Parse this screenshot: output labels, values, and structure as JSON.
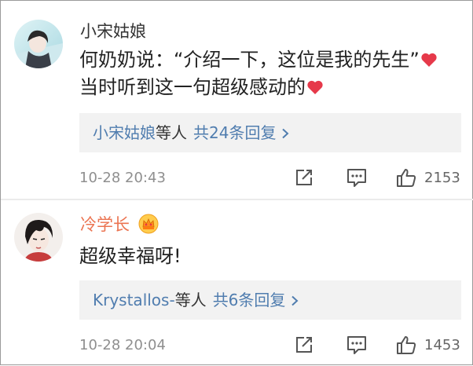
{
  "comments": [
    {
      "username": "小宋姑娘",
      "lines": [
        "何奶奶说：“介绍一下，这位是我的先生”",
        "当时听到这一句超级感动的"
      ],
      "replies": {
        "names": "小宋姑娘",
        "deng": "等人",
        "count": "共24条回复"
      },
      "timestamp": "10-28 20:43",
      "likes": "2153"
    },
    {
      "username": "冷学长",
      "lines": [
        "超级幸福呀!"
      ],
      "replies": {
        "names": "Krystallos-",
        "deng": "等人",
        "count": "共6条回复"
      },
      "timestamp": "10-28 20:04",
      "likes": "1453"
    }
  ],
  "colors": {
    "link_blue": "#507daf",
    "vip_orange": "#eb7350",
    "heart_red": "#e6394a",
    "meta_gray": "#8f8f8f",
    "reply_bg": "#f2f2f2"
  },
  "icons": [
    "heart-icon",
    "vip-crown-badge",
    "share-icon",
    "comment-icon",
    "like-icon",
    "chevron-right-icon"
  ]
}
